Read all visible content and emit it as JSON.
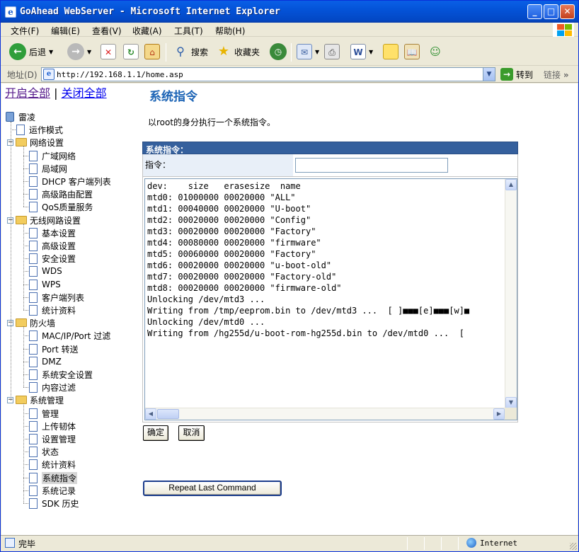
{
  "window": {
    "title": "GoAhead WebServer - Microsoft Internet Explorer",
    "minimize": "_",
    "maximize": "□",
    "close": "✕"
  },
  "menubar": {
    "items": [
      "文件(F)",
      "编辑(E)",
      "查看(V)",
      "收藏(A)",
      "工具(T)",
      "帮助(H)"
    ]
  },
  "toolbar": {
    "back_label": "后退",
    "search_label": "搜索",
    "favorites_label": "收藏夹"
  },
  "addressbar": {
    "label": "地址(D)",
    "url": "http://192.168.1.1/home.asp",
    "go_label": "转到",
    "links_label": "链接"
  },
  "tree": {
    "expand_all": "开启全部",
    "collapse_all": "关闭全部",
    "root": "雷凌",
    "items": [
      {
        "label": "运作模式",
        "type": "doc",
        "level": 1
      },
      {
        "label": "网络设置",
        "type": "folder",
        "level": 1
      },
      {
        "label": "广域网络",
        "type": "doc",
        "level": 2
      },
      {
        "label": "局域网",
        "type": "doc",
        "level": 2
      },
      {
        "label": "DHCP 客户端列表",
        "type": "doc",
        "level": 2
      },
      {
        "label": "高级路由配置",
        "type": "doc",
        "level": 2
      },
      {
        "label": "QoS质量服务",
        "type": "doc",
        "level": 2
      },
      {
        "label": "无线网路设置",
        "type": "folder",
        "level": 1
      },
      {
        "label": "基本设置",
        "type": "doc",
        "level": 2
      },
      {
        "label": "高级设置",
        "type": "doc",
        "level": 2
      },
      {
        "label": "安全设置",
        "type": "doc",
        "level": 2
      },
      {
        "label": "WDS",
        "type": "doc",
        "level": 2
      },
      {
        "label": "WPS",
        "type": "doc",
        "level": 2
      },
      {
        "label": "客户端列表",
        "type": "doc",
        "level": 2
      },
      {
        "label": "统计资料",
        "type": "doc",
        "level": 2
      },
      {
        "label": "防火墙",
        "type": "folder",
        "level": 1
      },
      {
        "label": "MAC/IP/Port 过滤",
        "type": "doc",
        "level": 2
      },
      {
        "label": "Port 转送",
        "type": "doc",
        "level": 2
      },
      {
        "label": "DMZ",
        "type": "doc",
        "level": 2
      },
      {
        "label": "系统安全设置",
        "type": "doc",
        "level": 2
      },
      {
        "label": "内容过滤",
        "type": "doc",
        "level": 2
      },
      {
        "label": "系统管理",
        "type": "folder",
        "level": 1
      },
      {
        "label": "管理",
        "type": "doc",
        "level": 2
      },
      {
        "label": "上传韧体",
        "type": "doc",
        "level": 2
      },
      {
        "label": "设置管理",
        "type": "doc",
        "level": 2
      },
      {
        "label": "状态",
        "type": "doc",
        "level": 2
      },
      {
        "label": "统计资料",
        "type": "doc",
        "level": 2
      },
      {
        "label": "系统指令",
        "type": "doc",
        "level": 2,
        "selected": true
      },
      {
        "label": "系统记录",
        "type": "doc",
        "level": 2
      },
      {
        "label": "SDK 历史",
        "type": "doc",
        "level": 2
      }
    ]
  },
  "main": {
    "title": "系统指令",
    "description": "以root的身分执行一个系统指令。",
    "panel_header": "系统指令：",
    "command_label": "指令：",
    "command_value": "",
    "output": "dev:    size   erasesize  name\nmtd0: 01000000 00020000 \"ALL\"\nmtd1: 00040000 00020000 \"U-boot\"\nmtd2: 00020000 00020000 \"Config\"\nmtd3: 00020000 00020000 \"Factory\"\nmtd4: 00080000 00020000 \"firmware\"\nmtd5: 00060000 00020000 \"Factory\"\nmtd6: 00020000 00020000 \"u-boot-old\"\nmtd7: 00020000 00020000 \"Factory-old\"\nmtd8: 00020000 00020000 \"firmware-old\"\nUnlocking /dev/mtd3 ...\nWriting from /tmp/eeprom.bin to /dev/mtd3 ...  [ ]■■■[e]■■■[w]■\nUnlocking /dev/mtd0 ...\nWriting from /hg255d/u-boot-rom-hg255d.bin to /dev/mtd0 ...  [",
    "ok_label": "确定",
    "cancel_label": "取消",
    "repeat_label": "Repeat Last Command"
  },
  "statusbar": {
    "text": "完毕",
    "zone": "Internet"
  }
}
